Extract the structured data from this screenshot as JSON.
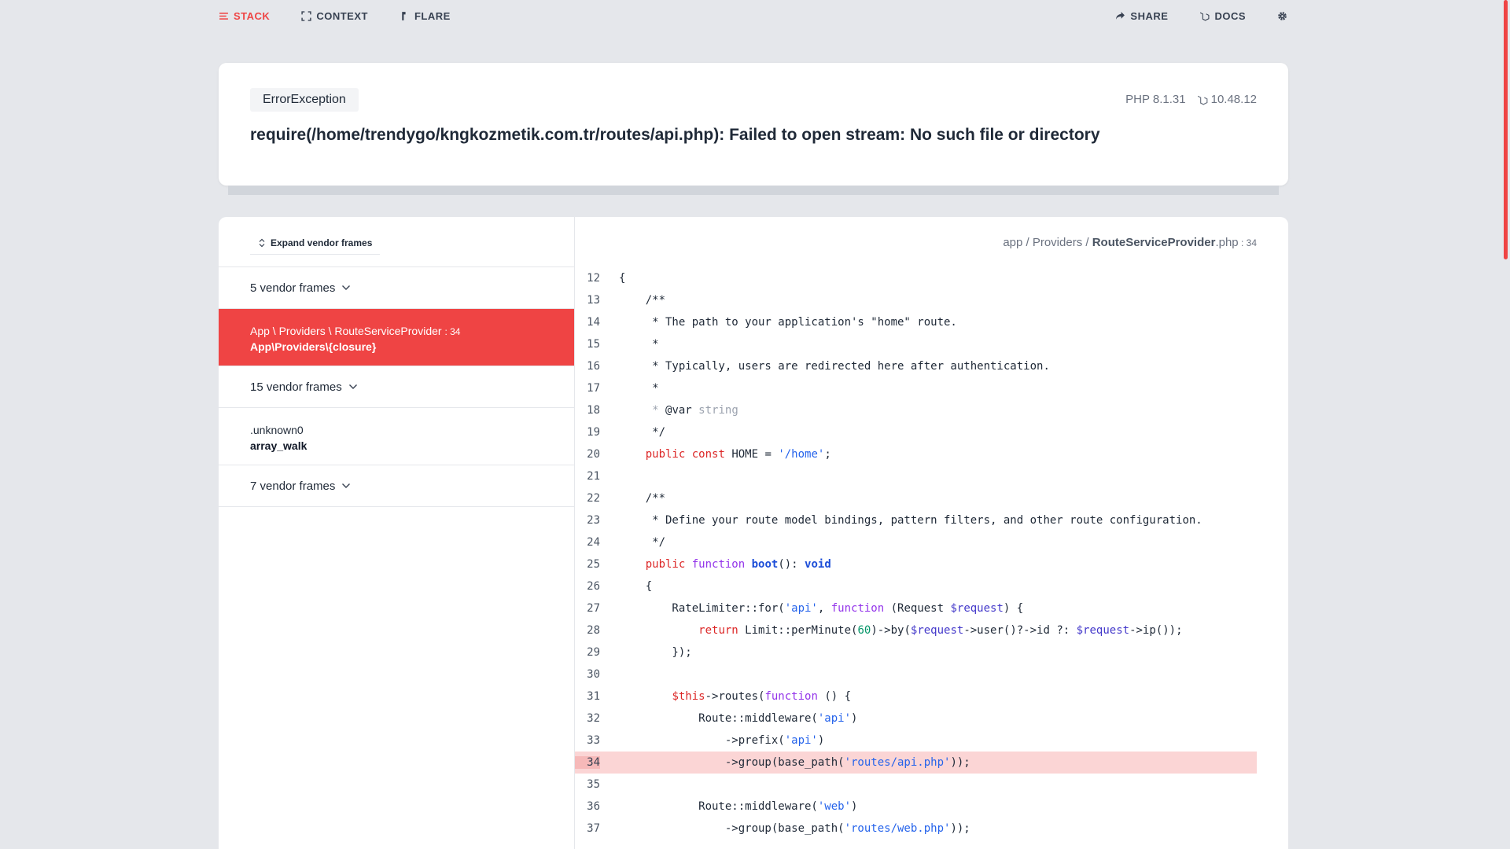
{
  "nav": {
    "stack": "STACK",
    "context": "CONTEXT",
    "flare": "FLARE",
    "share": "SHARE",
    "docs": "DOCS"
  },
  "error": {
    "exception": "ErrorException",
    "php_version": "PHP 8.1.31",
    "laravel_version": "10.48.12",
    "message": "require(/home/trendygo/kngkozmetik.com.tr/routes/api.php): Failed to open stream: No such file or directory"
  },
  "stack": {
    "expand_label": "Expand vendor frames",
    "vendor_group_1": "5 vendor frames",
    "active_frame": {
      "class": "App \\ Providers \\ RouteServiceProvider",
      "line": ": 34",
      "function": "App\\Providers\\{closure}"
    },
    "vendor_group_2": "15 vendor frames",
    "unknown_frame": {
      "class": ".unknown0",
      "function": "array_walk"
    },
    "vendor_group_3": "7 vendor frames"
  },
  "file": {
    "path": "app / Providers / ",
    "name": "RouteServiceProvider",
    "ext": ".php",
    "line": " : 34"
  },
  "code_lines": [
    "12",
    "13",
    "14",
    "15",
    "16",
    "17",
    "18",
    "19",
    "20",
    "21",
    "22",
    "23",
    "24",
    "25",
    "26",
    "27",
    "28",
    "29",
    "30",
    "31",
    "32",
    "33",
    "34",
    "35",
    "36",
    "37"
  ],
  "highlight_line": 34,
  "colors": {
    "accent": "#ef4444",
    "highlight": "#fbd5d5"
  }
}
